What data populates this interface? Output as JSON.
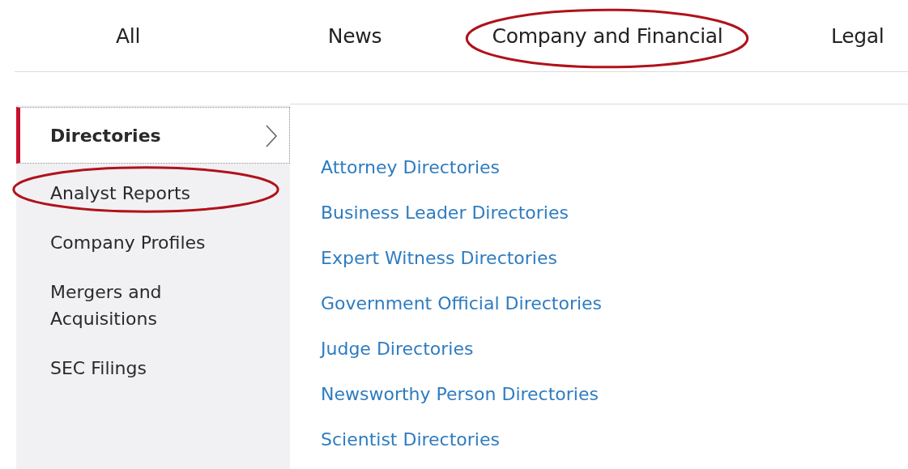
{
  "tabs": [
    {
      "label": "All",
      "circled": false
    },
    {
      "label": "News",
      "circled": false
    },
    {
      "label": "Company and Financial",
      "circled": true
    },
    {
      "label": "Legal",
      "circled": false
    }
  ],
  "sidebar": {
    "items": [
      {
        "label": "Directories",
        "selected": true,
        "circled": false
      },
      {
        "label": "Analyst Reports",
        "selected": false,
        "circled": true
      },
      {
        "label": "Company Profiles",
        "selected": false,
        "circled": false
      },
      {
        "label": "Mergers and Acquisitions",
        "selected": false,
        "circled": false
      },
      {
        "label": "SEC Filings",
        "selected": false,
        "circled": false
      }
    ]
  },
  "links": [
    "Attorney Directories",
    "Business Leader Directories",
    "Expert Witness Directories",
    "Government Official Directories",
    "Judge Directories",
    "Newsworthy Person Directories",
    "Scientist Directories"
  ]
}
